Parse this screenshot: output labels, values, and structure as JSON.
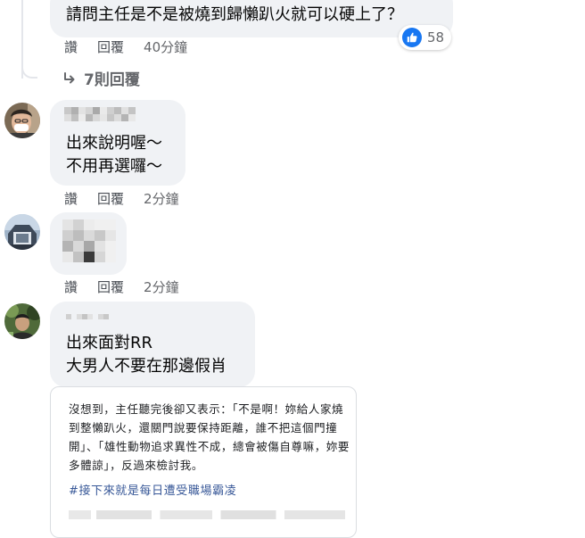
{
  "comments": [
    {
      "text_lines": [
        "請問主任是不是被燒到歸懶趴火就可以硬上了？"
      ],
      "actions": {
        "like": "讚",
        "reply": "回覆"
      },
      "time": "40分鐘",
      "reaction_count": "58",
      "reaction_icon": "thumbs-up-icon",
      "replies_link": "7則回覆"
    },
    {
      "text_lines": [
        "出來說明喔～",
        "不用再選囉～"
      ],
      "actions": {
        "like": "讚",
        "reply": "回覆"
      },
      "time": "2分鐘"
    },
    {
      "text_lines": [],
      "actions": {
        "like": "讚",
        "reply": "回覆"
      },
      "time": "2分鐘"
    },
    {
      "text_lines": [
        "出來面對RR",
        "大男人不要在那邊假肖"
      ],
      "link_preview": {
        "paragraph": "沒想到，主任聽完後卻又表示：「不是啊！妳給人家燒到整懶趴火，還關門說要保持距離，誰不把這個門撞開」、「雄性動物追求異性不成，總會被傷自尊嘛，妳要多體諒」，反過來檢討我。",
        "hashtag": "#接下來就是每日遭受職場霸凌"
      }
    }
  ],
  "colors": {
    "bubble_bg": "#f0f2f5",
    "action_text": "#4b4f56",
    "time_text": "#65676b",
    "like_blue": "#1877f2",
    "hashtag_blue": "#385898"
  }
}
